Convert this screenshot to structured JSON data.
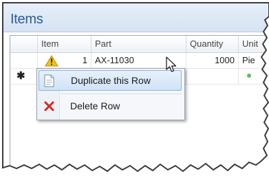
{
  "panel": {
    "title": "Items"
  },
  "grid": {
    "columns": [
      "",
      "Item",
      "Part",
      "Quantity",
      "Unit"
    ],
    "rows": [
      {
        "marker": "",
        "status_icon": "warning-icon",
        "item": "1",
        "part": "AX-11030",
        "quantity": "1000",
        "unit": "Pie"
      },
      {
        "marker": "✱",
        "status_icon": "",
        "item": "",
        "part": "",
        "quantity": "",
        "unit": ""
      }
    ]
  },
  "context_menu": {
    "items": [
      {
        "label": "Duplicate this Row",
        "icon": "copy-page-icon",
        "highlighted": true
      },
      {
        "label": "Delete Row",
        "icon": "delete-x-icon",
        "highlighted": false
      }
    ]
  },
  "colors": {
    "title": "#2c5a98",
    "highlight": "#cfe3f8",
    "delete": "#d9241c",
    "warning": "#f2c21b"
  }
}
